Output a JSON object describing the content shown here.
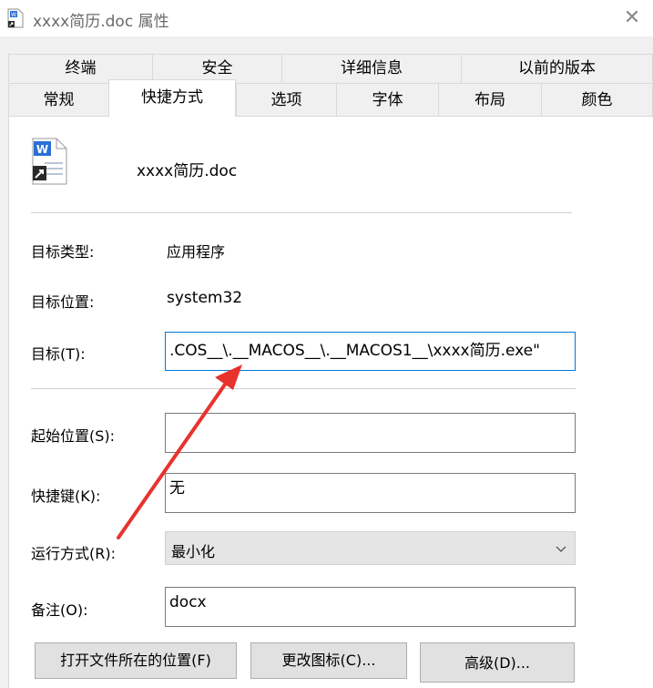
{
  "window": {
    "title": "xxxx简历.doc 属性"
  },
  "tabs_row1": [
    "终端",
    "安全",
    "详细信息",
    "以前的版本"
  ],
  "tabs_row2": [
    "常规",
    "快捷方式",
    "选项",
    "字体",
    "布局",
    "颜色"
  ],
  "header": {
    "filename": "xxxx简历.doc"
  },
  "fields": {
    "target_type": {
      "label": "目标类型:",
      "value": "应用程序"
    },
    "target_location": {
      "label": "目标位置:",
      "value": "system32"
    },
    "target": {
      "label": "目标(T):",
      "value": ".COS__\\.__MACOS__\\.__MACOS1__\\xxxx简历.exe\""
    },
    "start_in": {
      "label": "起始位置(S):",
      "value": ""
    },
    "shortcut_key": {
      "label": "快捷键(K):",
      "value": "无"
    },
    "run": {
      "label": "运行方式(R):",
      "value": "最小化"
    },
    "comment": {
      "label": "备注(O):",
      "value": "docx"
    }
  },
  "buttons": {
    "open_location": "打开文件所在的位置(F)",
    "change_icon": "更改图标(C)...",
    "advanced": "高级(D)..."
  },
  "colors": {
    "accent": "#0078d7",
    "annotation_arrow": "#e8322d",
    "word_blue": "#2b6fd6"
  }
}
